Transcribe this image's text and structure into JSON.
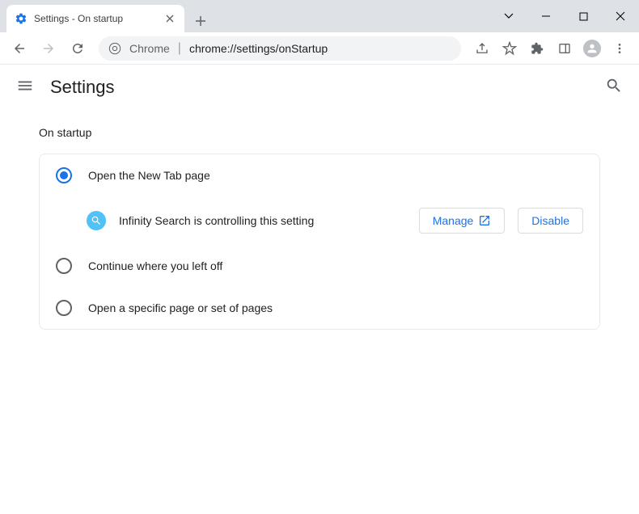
{
  "window": {
    "tab_title": "Settings - On startup"
  },
  "omnibox": {
    "host": "Chrome",
    "path": "chrome://settings/onStartup"
  },
  "header": {
    "title": "Settings"
  },
  "section": {
    "label": "On startup"
  },
  "options": {
    "new_tab": "Open the New Tab page",
    "continue": "Continue where you left off",
    "specific": "Open a specific page or set of pages"
  },
  "extension": {
    "message": "Infinity Search is controlling this setting",
    "manage": "Manage",
    "disable": "Disable"
  }
}
